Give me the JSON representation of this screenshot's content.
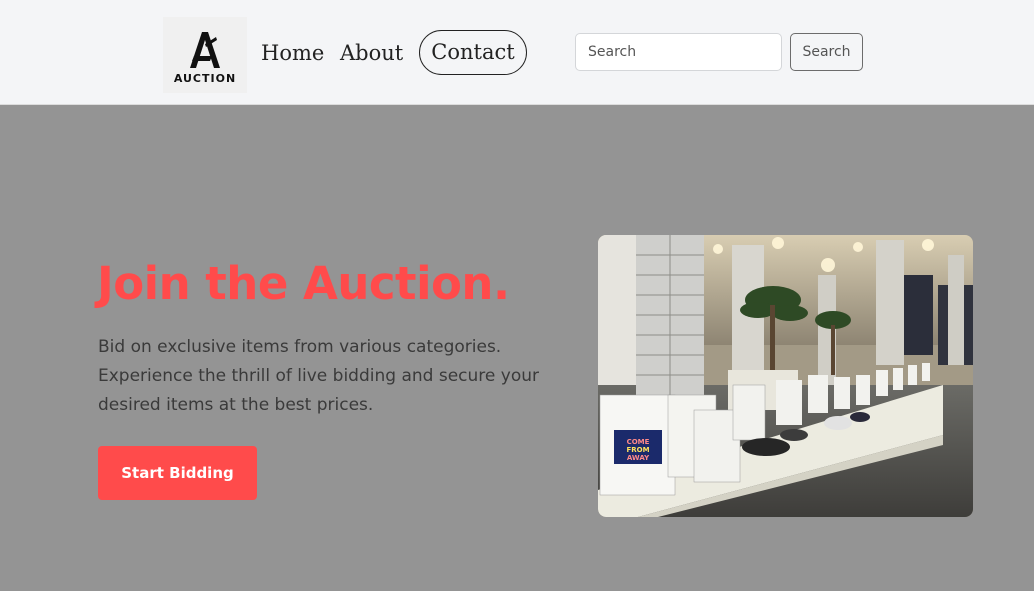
{
  "brand": {
    "logo_text": "AUCTION",
    "logo_icon": "auction-a-logo-icon"
  },
  "nav": {
    "home": "Home",
    "about": "About",
    "contact": "Contact"
  },
  "search": {
    "placeholder": "Search",
    "value": "",
    "button_label": "Search"
  },
  "hero": {
    "title": "Join the Auction.",
    "description": "Bid on exclusive items from various categories. Experience the thrill of live bidding and secure your desired items at the best prices.",
    "cta_label": "Start Bidding",
    "image_sign_text": [
      "COME",
      "FROM",
      "AWAY"
    ]
  },
  "colors": {
    "accent": "#ff4b4b",
    "navbar_bg": "#f4f5f7",
    "hero_bg": "#949494",
    "text": "#3a3a3a"
  }
}
